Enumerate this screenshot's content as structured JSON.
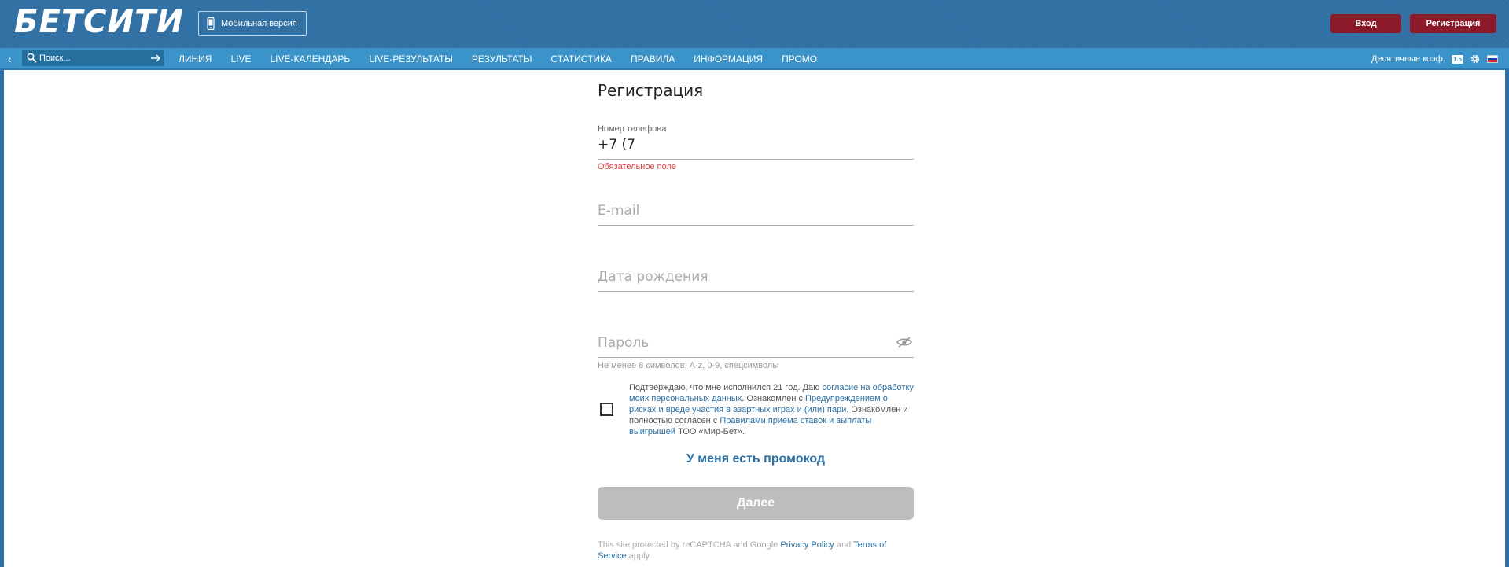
{
  "header": {
    "logo": "БЕТСИТИ",
    "mobile_version": "Мобильная версия",
    "login": "Вход",
    "register": "Регистрация"
  },
  "navbar": {
    "search_placeholder": "Поиск...",
    "items": [
      "ЛИНИЯ",
      "LIVE",
      "LIVE-КАЛЕНДАРЬ",
      "LIVE-РЕЗУЛЬТАТЫ",
      "РЕЗУЛЬТАТЫ",
      "СТАТИСТИКА",
      "ПРАВИЛА",
      "ИНФОРМАЦИЯ",
      "ПРОМО"
    ],
    "odds_label": "Десятичные коэф.",
    "odds_badge": "1.5"
  },
  "form": {
    "title": "Регистрация",
    "phone_label": "Номер телефона",
    "phone_value": "+7 (7",
    "phone_error": "Обязательное поле",
    "email_placeholder": "E-mail",
    "birthdate_placeholder": "Дата рождения",
    "password_placeholder": "Пароль",
    "password_hint": "Не менее 8 символов: A-z, 0-9, спецсимволы",
    "consent": {
      "part1": "Подтверждаю, что мне исполнился 21 год. Даю ",
      "link1": "согласие на обработку моих персональных данных",
      "part2": ". Ознакомлен с ",
      "link2": "Предупреждением о рисках и вреде участия в азартных играх и (или) пари",
      "part3": ". Ознакомлен и полностью согласен с ",
      "link3": "Правилами приема ставок и выплаты выигрышей",
      "part4": " ТОО «Мир-Бет»."
    },
    "promo": "У меня есть промокод",
    "next": "Далее",
    "recaptcha": {
      "part1": "This site protected by reCAPTCHA and Google ",
      "privacy": "Privacy Policy",
      "and": " and ",
      "terms": "Terms of Service",
      "part2": " apply"
    }
  }
}
